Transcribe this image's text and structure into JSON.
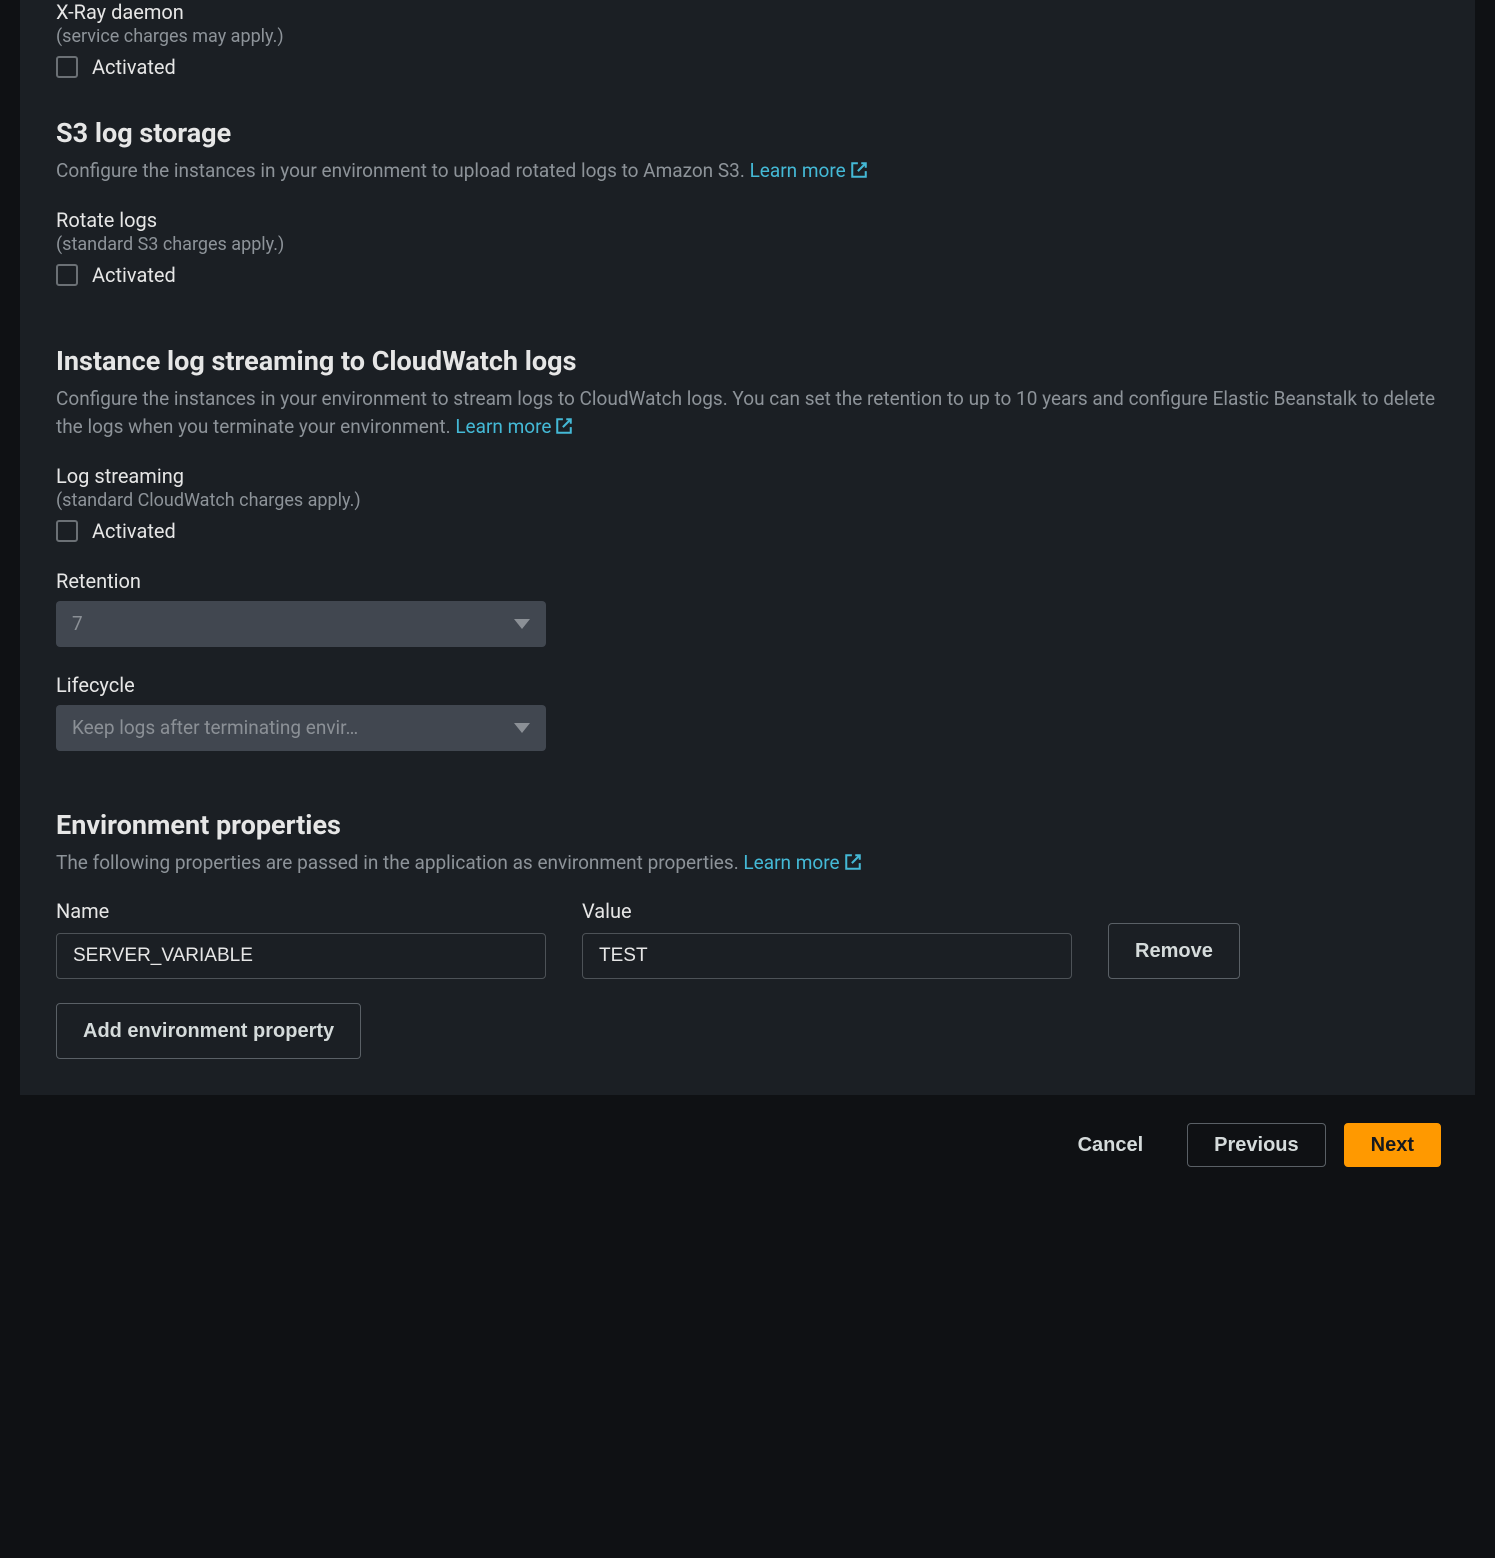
{
  "xray": {
    "title": "X-Ray daemon",
    "sub": "(service charges may apply.)",
    "checkbox_label": "Activated"
  },
  "s3": {
    "title": "S3 log storage",
    "desc": "Configure the instances in your environment to upload rotated logs to Amazon S3. ",
    "learn_more": "Learn more",
    "rotate_label": "Rotate logs",
    "rotate_sub": "(standard S3 charges apply.)",
    "checkbox_label": "Activated"
  },
  "cw": {
    "title": "Instance log streaming to CloudWatch logs",
    "desc": "Configure the instances in your environment to stream logs to CloudWatch logs. You can set the retention to up to 10 years and configure Elastic Beanstalk to delete the logs when you terminate your environment. ",
    "learn_more": "Learn more",
    "stream_label": "Log streaming",
    "stream_sub": "(standard CloudWatch charges apply.)",
    "checkbox_label": "Activated",
    "retention_label": "Retention",
    "retention_value": "7",
    "lifecycle_label": "Lifecycle",
    "lifecycle_value": "Keep logs after terminating envir…"
  },
  "envprops": {
    "title": "Environment properties",
    "desc": "The following properties are passed in the application as environment properties. ",
    "learn_more": "Learn more",
    "name_label": "Name",
    "value_label": "Value",
    "rows": [
      {
        "name": "SERVER_VARIABLE",
        "value": "TEST"
      }
    ],
    "remove_label": "Remove",
    "add_label": "Add environment property"
  },
  "footer": {
    "cancel": "Cancel",
    "previous": "Previous",
    "next": "Next"
  }
}
